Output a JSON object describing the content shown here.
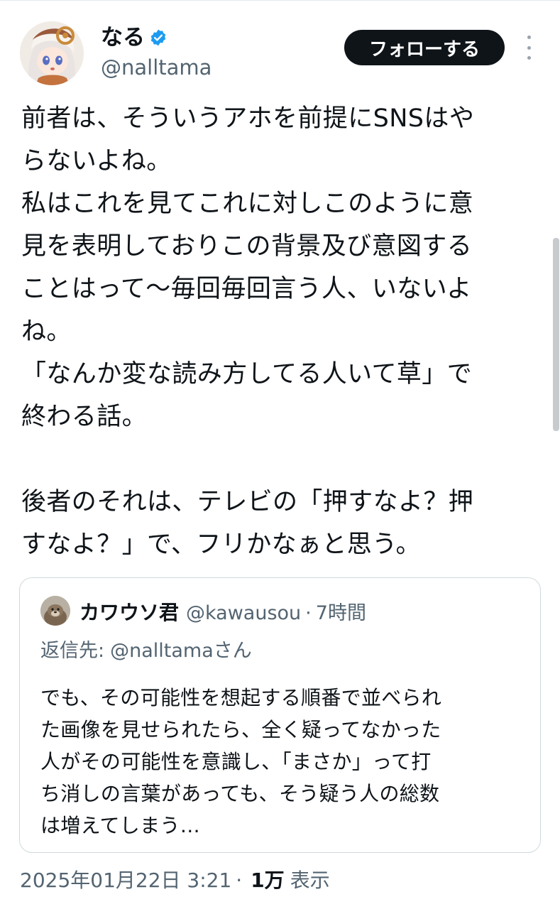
{
  "author": {
    "display_name": "なる",
    "handle": "@nalltama",
    "avatar_icon": "anime-girl-avatar",
    "verified_icon": "verified-badge-icon",
    "verified_color": "#1d9bf0"
  },
  "follow_button": {
    "label": "フォローする"
  },
  "more_menu_icon": "vertical-ellipsis-icon",
  "tweet_lines": [
    "前者は、そういうアホを前提にSNSはや",
    "らないよね。",
    "私はこれを見てこれに対しこのように意",
    "見を表明しておりこの背景及び意図する",
    "ことはって〜毎回毎回言う人、いないよ",
    "ね。",
    "「なんか変な読み方してる人いて草」で",
    "終わる話。",
    "",
    "後者のそれは、テレビの「押すなよ？押",
    "すなよ？」で、フリかなぁと思う。"
  ],
  "quote": {
    "display_name": "カワウソ君",
    "handle": "@kawausou",
    "separator": "·",
    "time": "7時間",
    "avatar_icon": "otter-avatar",
    "reply_prefix": "返信先:",
    "reply_handle": "@nalltamaさん",
    "text_lines": [
      "でも、その可能性を想起する順番で並べられ",
      "た画像を見せられたら、全く疑ってなかった",
      "人がその可能性を意識し、「まさか」って打",
      "ち消しの言葉があっても、そう疑う人の総数",
      "は増えてしまう…"
    ]
  },
  "meta": {
    "timestamp": "2025年01月22日 3:21",
    "separator": "·",
    "views_count": "1万",
    "views_label": "表示"
  }
}
